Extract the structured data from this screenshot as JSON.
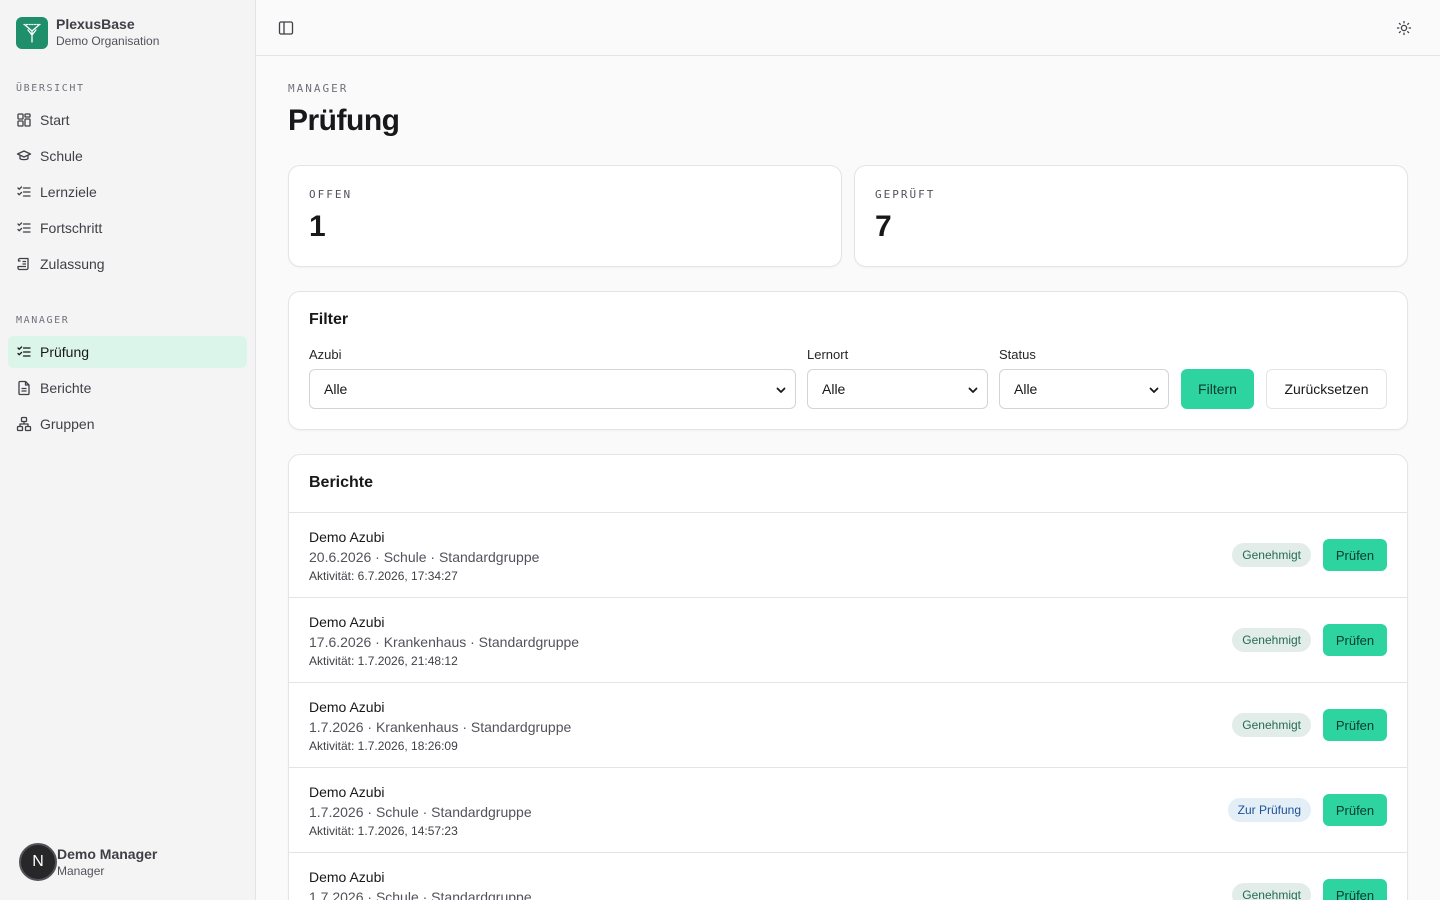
{
  "brand": {
    "name": "PlexusBase",
    "org": "Demo Organisation"
  },
  "sidebar": {
    "overview_label": "ÜBERSICHT",
    "overview_items": [
      {
        "label": "Start",
        "icon": "dashboard-icon"
      },
      {
        "label": "Schule",
        "icon": "graduation-cap-icon"
      },
      {
        "label": "Lernziele",
        "icon": "list-checks-icon"
      },
      {
        "label": "Fortschritt",
        "icon": "list-checks-icon"
      },
      {
        "label": "Zulassung",
        "icon": "scroll-icon"
      }
    ],
    "manager_label": "MANAGER",
    "manager_items": [
      {
        "label": "Prüfung",
        "icon": "list-checks-icon",
        "active": true
      },
      {
        "label": "Berichte",
        "icon": "file-text-icon"
      },
      {
        "label": "Gruppen",
        "icon": "network-icon"
      }
    ]
  },
  "user": {
    "initial": "N",
    "name": "Demo Manager",
    "role": "Manager"
  },
  "page": {
    "eyebrow": "MANAGER",
    "title": "Prüfung"
  },
  "stats": [
    {
      "label": "OFFEN",
      "value": "1"
    },
    {
      "label": "GEPRÜFT",
      "value": "7"
    }
  ],
  "filter": {
    "title": "Filter",
    "azubi": {
      "label": "Azubi",
      "value": "Alle"
    },
    "lernort": {
      "label": "Lernort",
      "value": "Alle"
    },
    "status": {
      "label": "Status",
      "value": "Alle"
    },
    "apply_label": "Filtern",
    "reset_label": "Zurücksetzen"
  },
  "reports": {
    "title": "Berichte",
    "action_label": "Prüfen",
    "rows": [
      {
        "name": "Demo Azubi",
        "meta": "20.6.2026 · Schule · Standardgruppe",
        "activity": "Aktivität: 6.7.2026, 17:34:27",
        "status": "Genehmigt",
        "status_kind": "ok"
      },
      {
        "name": "Demo Azubi",
        "meta": "17.6.2026 · Krankenhaus · Standardgruppe",
        "activity": "Aktivität: 1.7.2026, 21:48:12",
        "status": "Genehmigt",
        "status_kind": "ok"
      },
      {
        "name": "Demo Azubi",
        "meta": "1.7.2026 · Krankenhaus · Standardgruppe",
        "activity": "Aktivität: 1.7.2026, 18:26:09",
        "status": "Genehmigt",
        "status_kind": "ok"
      },
      {
        "name": "Demo Azubi",
        "meta": "1.7.2026 · Schule · Standardgruppe",
        "activity": "Aktivität: 1.7.2026, 14:57:23",
        "status": "Zur Prüfung",
        "status_kind": "review"
      },
      {
        "name": "Demo Azubi",
        "meta": "1.7.2026 · Schule · Standardgruppe",
        "activity": "",
        "status": "Genehmigt",
        "status_kind": "ok"
      }
    ]
  },
  "colors": {
    "accent": "#2dd4a0",
    "brand": "#1e8f6a",
    "active_nav_bg": "#dcf5ea"
  }
}
